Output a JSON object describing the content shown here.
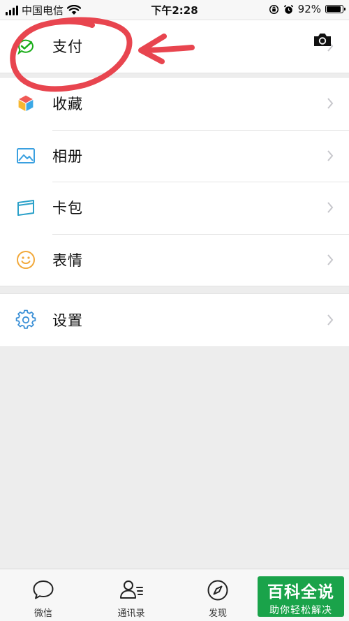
{
  "status_bar": {
    "carrier": "中国电信",
    "time": "下午2:28",
    "battery": "92%",
    "battery_level": 0.92
  },
  "menu_sections": [
    [
      {
        "id": "pay",
        "label": "支付",
        "icon": "wechat-pay-icon"
      }
    ],
    [
      {
        "id": "favorites",
        "label": "收藏",
        "icon": "cube-icon"
      },
      {
        "id": "album",
        "label": "相册",
        "icon": "picture-icon"
      },
      {
        "id": "cards",
        "label": "卡包",
        "icon": "card-wallet-icon"
      },
      {
        "id": "stickers",
        "label": "表情",
        "icon": "smiley-icon"
      }
    ],
    [
      {
        "id": "settings",
        "label": "设置",
        "icon": "gear-icon"
      }
    ]
  ],
  "tabs": [
    {
      "id": "chats",
      "label": "微信",
      "icon": "chat-bubble-icon"
    },
    {
      "id": "contacts",
      "label": "通讯录",
      "icon": "contacts-icon"
    },
    {
      "id": "discover",
      "label": "发现",
      "icon": "compass-icon"
    }
  ],
  "watermark": {
    "title": "百科全说",
    "subtitle": "助你轻松解决"
  },
  "colors": {
    "accent_green": "#1aad19",
    "annotation_red": "#e8454f",
    "background": "#ededed"
  }
}
